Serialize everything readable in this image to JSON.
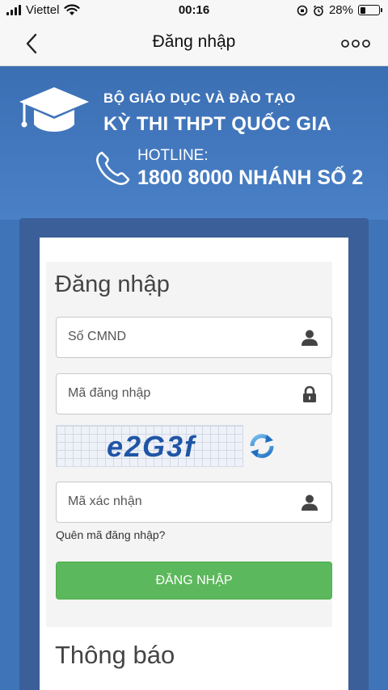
{
  "status_bar": {
    "carrier": "Viettel",
    "time": "00:16",
    "battery": "28%",
    "battery_level": 0.28
  },
  "nav": {
    "title": "Đăng nhập",
    "back_icon": "chevron-left-icon",
    "more_icon": "more-horizontal-icon"
  },
  "banner": {
    "ministry": "BỘ GIÁO DỤC VÀ ĐÀO TẠO",
    "exam": "KỲ THI THPT QUỐC GIA",
    "hotline_label": "HOTLINE:",
    "hotline_number": "1800 8000 NHÁNH SỐ 2"
  },
  "login": {
    "title": "Đăng nhập",
    "id_placeholder": "Số CMND",
    "password_placeholder": "Mã đăng nhập",
    "captcha_code": "e2G3f",
    "captcha_input_placeholder": "Mã xác nhận",
    "forgot_link": "Quên mã đăng nhập?",
    "submit_label": "ĐĂNG NHẬP"
  },
  "notice": {
    "title": "Thông báo"
  },
  "colors": {
    "banner_blue": "#3f74b8",
    "button_green": "#5cb85c"
  }
}
